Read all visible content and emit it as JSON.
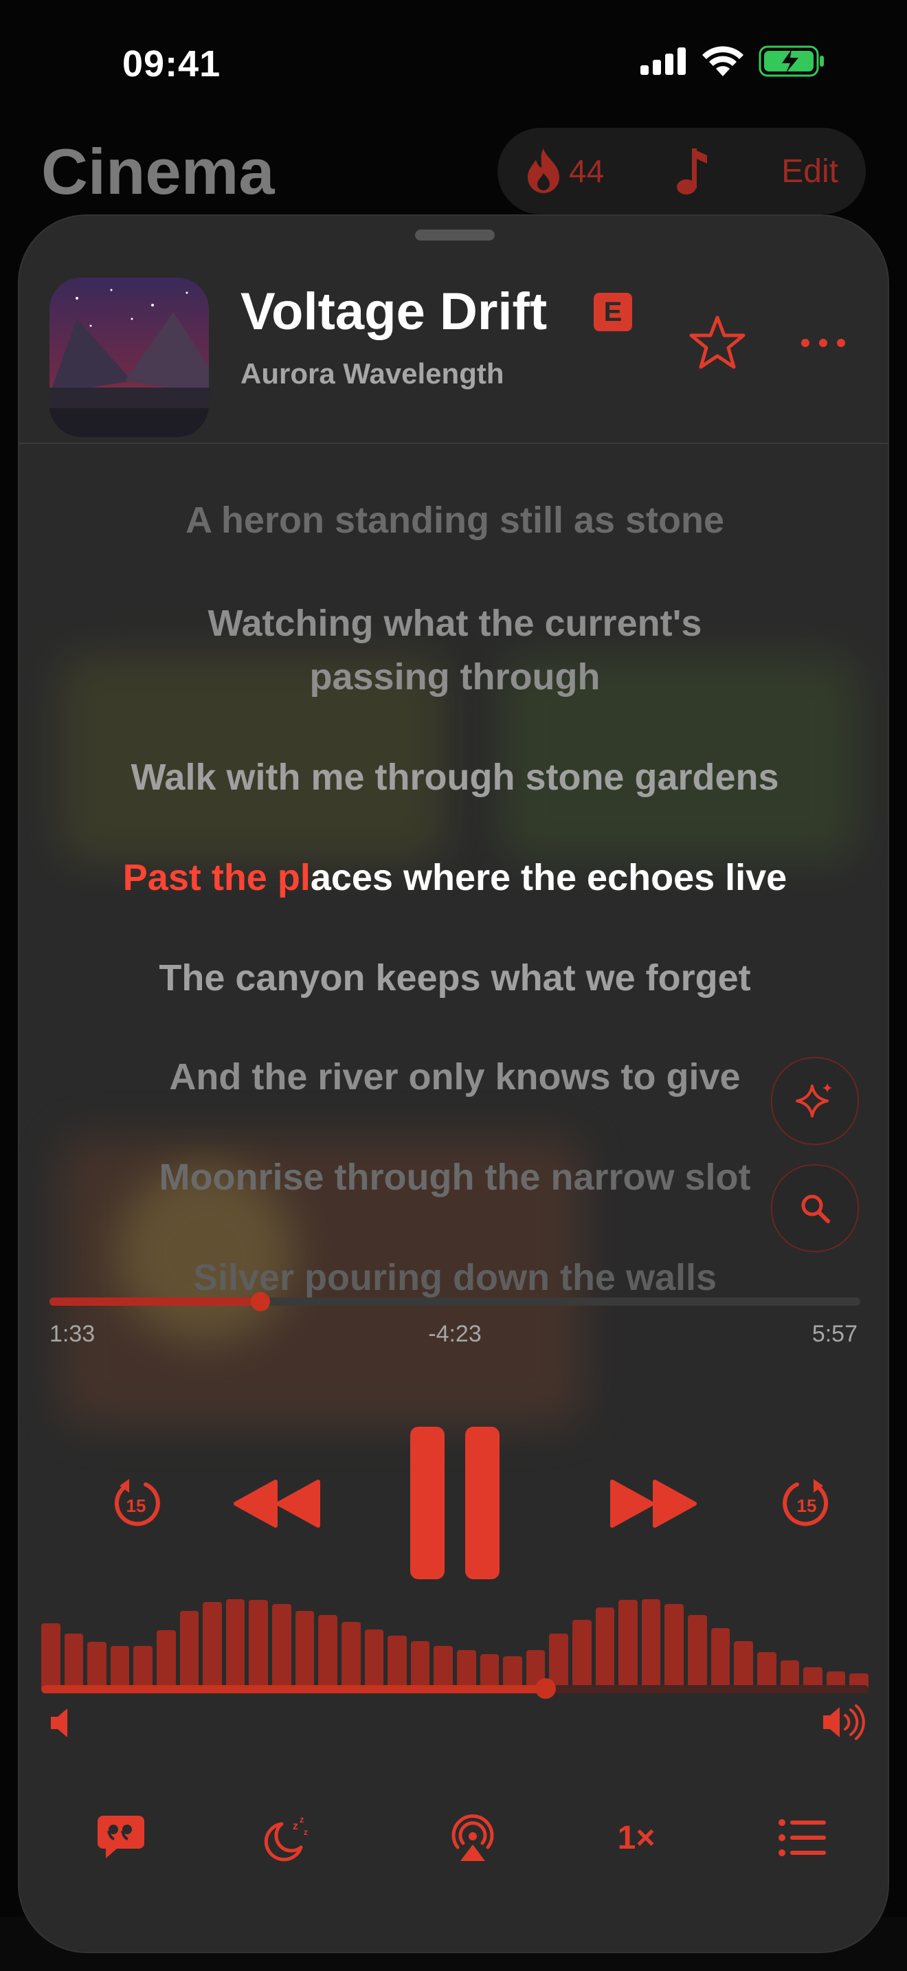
{
  "status": {
    "time": "09:41"
  },
  "background": {
    "title": "Cinema",
    "pill_count": "44",
    "pill_edit": "Edit"
  },
  "player": {
    "title": "Voltage Drift",
    "explicit_badge": "E",
    "artist": "Aurora Wavelength",
    "lyrics": [
      {
        "text": "A heron standing still as stone"
      },
      {
        "text1": "Watching what the current's",
        "text2": "passing through"
      },
      {
        "text": "Walk with me through stone gardens"
      },
      {
        "sung": "Past the pl",
        "rest": "aces where the echoes live"
      },
      {
        "text": "The canyon keeps what we forget"
      },
      {
        "text": "And the river only knows to give"
      },
      {
        "text": "Moonrise through the narrow slot"
      },
      {
        "text": "Silver pouring down the walls"
      }
    ],
    "elapsed": "1:33",
    "remaining": "-4:23",
    "duration": "5:57",
    "progress_fraction": 0.26,
    "skip_back_seconds": "15",
    "skip_forward_seconds": "15",
    "volume_fraction": 0.61,
    "visualizer_levels": [
      0.62,
      0.52,
      0.44,
      0.4,
      0.4,
      0.55,
      0.74,
      0.82,
      0.85,
      0.84,
      0.8,
      0.74,
      0.7,
      0.63,
      0.56,
      0.5,
      0.45,
      0.4,
      0.36,
      0.32,
      0.3,
      0.36,
      0.52,
      0.65,
      0.77,
      0.84,
      0.85,
      0.8,
      0.7,
      0.57,
      0.45,
      0.34,
      0.26,
      0.2,
      0.16,
      0.14
    ],
    "playback_rate": "1×",
    "accent_color": "#ff3b30"
  }
}
